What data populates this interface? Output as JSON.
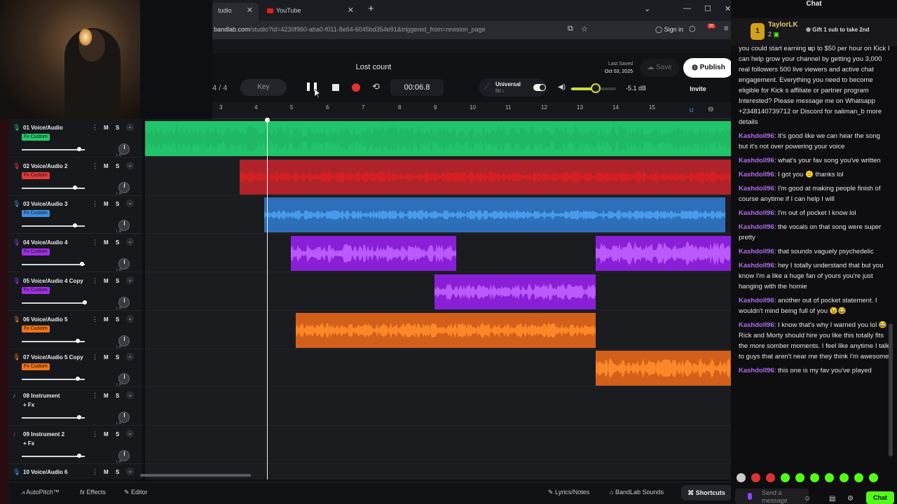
{
  "browser": {
    "tabs": [
      {
        "label": "tudio"
      },
      {
        "label": "YouTube"
      }
    ],
    "url_host": "bandlab.com",
    "url_rest": "/studio?id=4230f960-aba0-f011-8e64-6045bd354e91&triggered_from=revision_page",
    "sign_in": "Sign in",
    "notif_count": "35"
  },
  "studio": {
    "project_title": "Lost count",
    "time_signature": "4 / 4",
    "key_label": "Key",
    "time_display": "00:06.8",
    "instrument_name": "Universal",
    "instrument_bpm": "50",
    "volume_db": "-5.1 dB",
    "volume_level_pct": 55,
    "last_saved_label": "Last Saved",
    "last_saved_date": "Oct 03, 2025",
    "save_label": "Save",
    "publish_label": "Publish",
    "invite_label": "Invite"
  },
  "ruler": [
    "3",
    "4",
    "5",
    "6",
    "7",
    "8",
    "9",
    "10",
    "11",
    "12",
    "13",
    "14",
    "15"
  ],
  "tracks": [
    {
      "num": "01",
      "name": "Voice/Audio",
      "fx": "Fx Custom",
      "color": "#27c86a",
      "icon": "mic-icon",
      "vol": 0.95
    },
    {
      "num": "02",
      "name": "Voice/Audio 2",
      "fx": "Fx Custom",
      "color": "#e8393a",
      "icon": "mic-icon",
      "vol": 0.88
    },
    {
      "num": "03",
      "name": "Voice/Audio 3",
      "fx": "Fx Custom",
      "color": "#3d8fe0",
      "icon": "mic-icon",
      "vol": 0.88
    },
    {
      "num": "04",
      "name": "Voice/Audio 4",
      "fx": "Fx Custom",
      "color": "#a32ee8",
      "icon": "mic-icon",
      "vol": 1.0
    },
    {
      "num": "05",
      "name": "Voice/Audio 4 Copy",
      "fx": "Fx Custom",
      "color": "#a32ee8",
      "icon": "mic-icon",
      "vol": 1.05
    },
    {
      "num": "06",
      "name": "Voice/Audio 5",
      "fx": "Fx Custom",
      "color": "#f0751a",
      "icon": "mic-icon",
      "vol": 0.93
    },
    {
      "num": "07",
      "name": "Voice/Audio 5 Copy",
      "fx": "Fx Custom",
      "color": "#f0751a",
      "icon": "mic-icon",
      "vol": 0.93
    },
    {
      "num": "08",
      "name": "Instrument",
      "fx": "+ Fx",
      "color": "",
      "icon": "instrument-icon",
      "vol": 0.95
    },
    {
      "num": "09",
      "name": "Instrument 2",
      "fx": "+ Fx",
      "color": "",
      "icon": "instrument-icon",
      "vol": 0.95
    },
    {
      "num": "10",
      "name": "Voice/Audio 6",
      "fx": "",
      "color": "",
      "icon": "mic-icon",
      "vol": 0.95
    }
  ],
  "track_controls": {
    "mute": "M",
    "solo": "S",
    "menu": "⋮",
    "pan_lr": "L   R"
  },
  "bottom_bar": {
    "autopitch": "AutoPitch™",
    "effects": "Effects",
    "editor": "Editor",
    "lyrics": "Lyrics/Notes",
    "sounds": "BandLab Sounds",
    "shortcuts": "Shortcuts"
  },
  "chat": {
    "title": "Chat",
    "gift_user": "TaylorLK",
    "gift_count": "2",
    "gift_text": "Gift 1 sub to take 2nd",
    "messages": [
      {
        "user": "",
        "text": "you could start earning up to $50 per hour on Kick I can help grow your channel by getting you 3,000 real followers 500 live viewers and active chat engagement. Everything you need to become eligible for Kick s affiliate or partner program Interested? Please message me on Whatsapp +2348140739712 or Discord for saliman_b more details"
      },
      {
        "user": "Kashdoll96",
        "text": "It's good like we can hear the song but it's not over powering your voice"
      },
      {
        "user": "Kashdoll96",
        "text": "what's your fav song you've written"
      },
      {
        "user": "Kashdoll96",
        "text": "I got you 🙂 thanks lol"
      },
      {
        "user": "Kashdoll96",
        "text": "I'm good at making people finish of course anytime if I can help I will"
      },
      {
        "user": "Kashdoll96",
        "text": "I'm out of pocket I know lol"
      },
      {
        "user": "Kashdoll96",
        "text": "the vocals on that song were super pretty"
      },
      {
        "user": "Kashdoll96",
        "text": "that sounds vaguely psychedelic"
      },
      {
        "user": "Kashdoll96",
        "text": "hey I totally understand that but you know I'm a like a huge fan of yours you're just hanging with the homie"
      },
      {
        "user": "Kashdoll96",
        "text": "another out of pocket statement. I wouldn't mind being full of you 😉😂"
      },
      {
        "user": "Kashdoll96",
        "text": "I know that's why I warned you lol 😂 Rick and Morty should hire you like this totally fits the more somber moments. I feel like anytime I talk to guys that aren't near me they think I'm awesome"
      },
      {
        "user": "Kashdoll96",
        "text": "this one is my fav you've played"
      }
    ],
    "input_placeholder": "Send a message",
    "send_label": "Chat"
  }
}
